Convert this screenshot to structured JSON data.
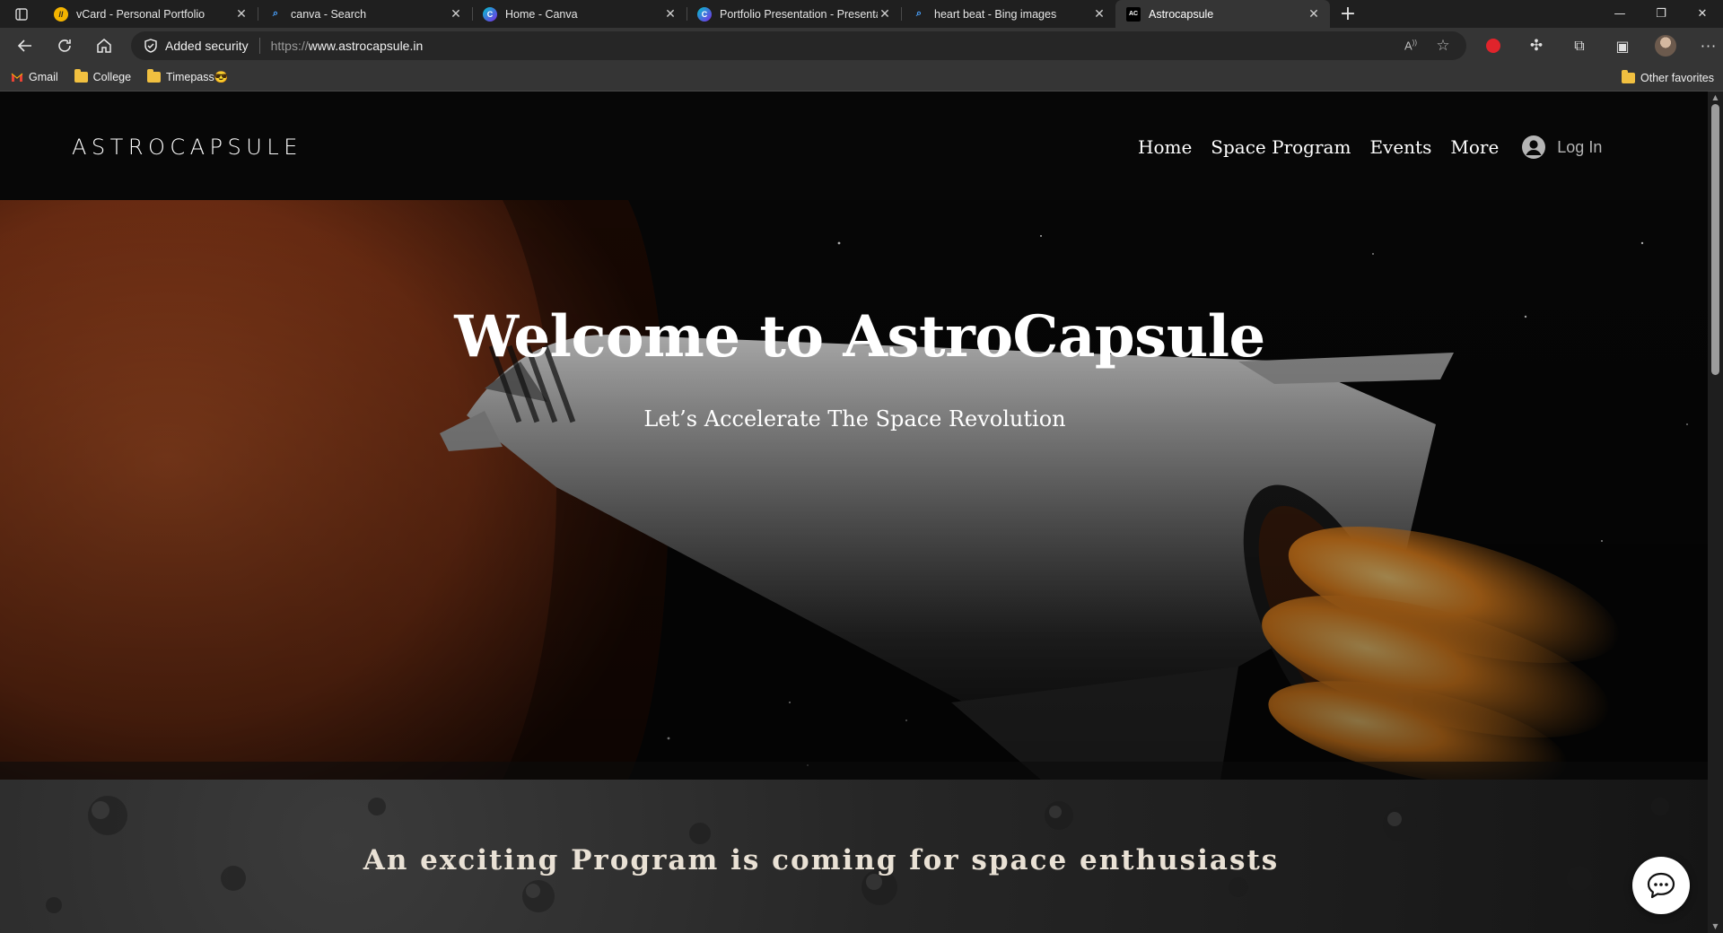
{
  "browser": {
    "tabs": [
      {
        "title": "vCard - Personal Portfolio",
        "icon": "vcard-favicon",
        "active": false
      },
      {
        "title": "canva - Search",
        "icon": "search-favicon",
        "active": false
      },
      {
        "title": "Home - Canva",
        "icon": "canva-favicon",
        "active": false
      },
      {
        "title": "Portfolio Presentation - Presenta",
        "icon": "canva-favicon",
        "active": false
      },
      {
        "title": "heart beat - Bing images",
        "icon": "search-favicon",
        "active": false
      },
      {
        "title": "Astrocapsule",
        "icon": "astrocapsule-favicon",
        "active": true
      }
    ],
    "address": {
      "security_label": "Added security",
      "scheme": "https://",
      "host": "www.astrocapsule.in"
    },
    "favorites": [
      {
        "label": "Gmail",
        "icon": "gmail-icon"
      },
      {
        "label": "College",
        "icon": "folder-icon"
      },
      {
        "label": "Timepass😎",
        "icon": "folder-icon"
      }
    ],
    "other_favorites": "Other favorites",
    "colors": {
      "tabbar": "#1f1f1f",
      "toolbar": "#353535",
      "omnibox": "#262626"
    }
  },
  "site": {
    "logo": "ASTROCAPSULE",
    "nav": [
      "Home",
      "Space Program",
      "Events",
      "More"
    ],
    "login_label": "Log In",
    "hero": {
      "title": "Welcome to AstroCapsule",
      "subtitle": "Let’s Accelerate The Space Revolution"
    },
    "section2": {
      "title": "An exciting Program is coming for space enthusiasts"
    },
    "colors": {
      "planet": "#8a3a18",
      "flame": "#f08a20",
      "header": "#070707"
    }
  }
}
